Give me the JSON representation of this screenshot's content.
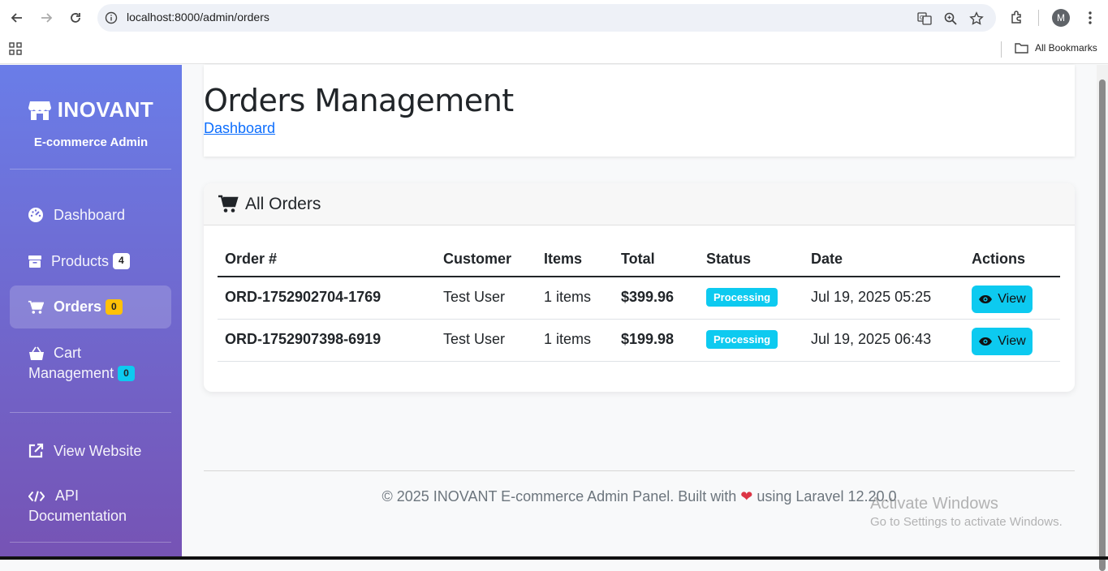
{
  "browser": {
    "url": "localhost:8000/admin/orders",
    "avatar_letter": "M",
    "bookmarks_label": "All Bookmarks"
  },
  "sidebar": {
    "brand": "INOVANT",
    "subtitle": "E-commerce Admin",
    "items": [
      {
        "label": "Dashboard",
        "icon": "gauge-icon"
      },
      {
        "label": "Products",
        "icon": "box-icon",
        "badge": "4"
      },
      {
        "label": "Orders",
        "icon": "shopping-cart-icon",
        "badge": "0",
        "active": true
      },
      {
        "label_line1": "Cart",
        "label_line2": "Management",
        "icon": "basket-icon",
        "badge": "0"
      },
      {
        "label": "View Website",
        "icon": "external-link-icon"
      },
      {
        "label_line1": "API",
        "label_line2": "Documentation",
        "icon": "code-icon"
      }
    ]
  },
  "header": {
    "title": "Orders Management",
    "breadcrumb": "Dashboard"
  },
  "orders": {
    "title": "All Orders",
    "columns": [
      "Order #",
      "Customer",
      "Items",
      "Total",
      "Status",
      "Date",
      "Actions"
    ],
    "rows": [
      {
        "order": "ORD-1752902704-1769",
        "customer": "Test User",
        "items": "1 items",
        "total": "$399.96",
        "status": "Processing",
        "date": "Jul 19, 2025 05:25",
        "action": "View"
      },
      {
        "order": "ORD-1752907398-6919",
        "customer": "Test User",
        "items": "1 items",
        "total": "$199.98",
        "status": "Processing",
        "date": "Jul 19, 2025 06:43",
        "action": "View"
      }
    ]
  },
  "footer": {
    "before": "© 2025 INOVANT E-commerce Admin Panel. Built with",
    "after": "using Laravel 12.20.0"
  },
  "watermark": {
    "line1": "Activate Windows",
    "line2": "Go to Settings to activate Windows."
  },
  "colors": {
    "sidebar_top": "#6a7de8",
    "sidebar_bottom": "#7653b4",
    "status": "#0dcaf0",
    "link": "#0d6efd"
  }
}
